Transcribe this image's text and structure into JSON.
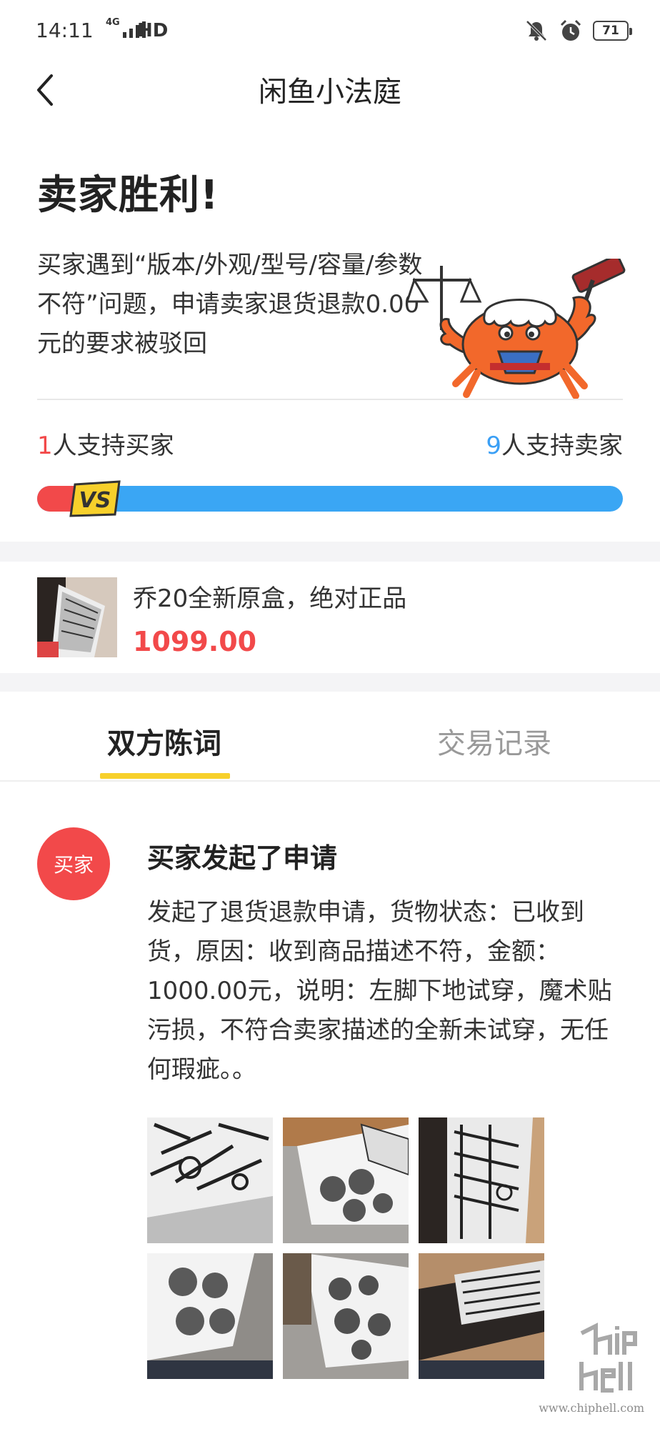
{
  "status_bar": {
    "time": "14:11",
    "network": "4G",
    "hd": "HD",
    "battery": "71"
  },
  "nav": {
    "title": "闲鱼小法庭"
  },
  "verdict": {
    "title": "卖家胜利!",
    "description": "买家遇到“版本/外观/型号/容量/参数不符”问题，申请卖家退货退款0.00元的要求被驳回"
  },
  "support": {
    "buyer_count": "1",
    "buyer_label": "人支持买家",
    "seller_count": "9",
    "seller_label": "人支持卖家",
    "buyer_fraction": 0.1,
    "vs_label": "VS",
    "colors": {
      "buyer": "#f2494a",
      "seller": "#3aa6f4"
    }
  },
  "product": {
    "title": "乔20全新原盒，绝对正品",
    "price": "1099.00"
  },
  "tabs": [
    {
      "label": "双方陈词",
      "active": true
    },
    {
      "label": "交易记录",
      "active": false
    }
  ],
  "statement": {
    "role": "买家",
    "title": "买家发起了申请",
    "body": "发起了退货退款申请，货物状态：已收到货，原因：收到商品描述不符，金额：1000.00元，说明：左脚下地试穿，魔术贴污损，不符合卖家描述的全新未试穿，无任何瑕疵。。",
    "photo_count": 6
  },
  "watermark": {
    "logo": "chip hell",
    "url": "www.chiphell.com"
  }
}
